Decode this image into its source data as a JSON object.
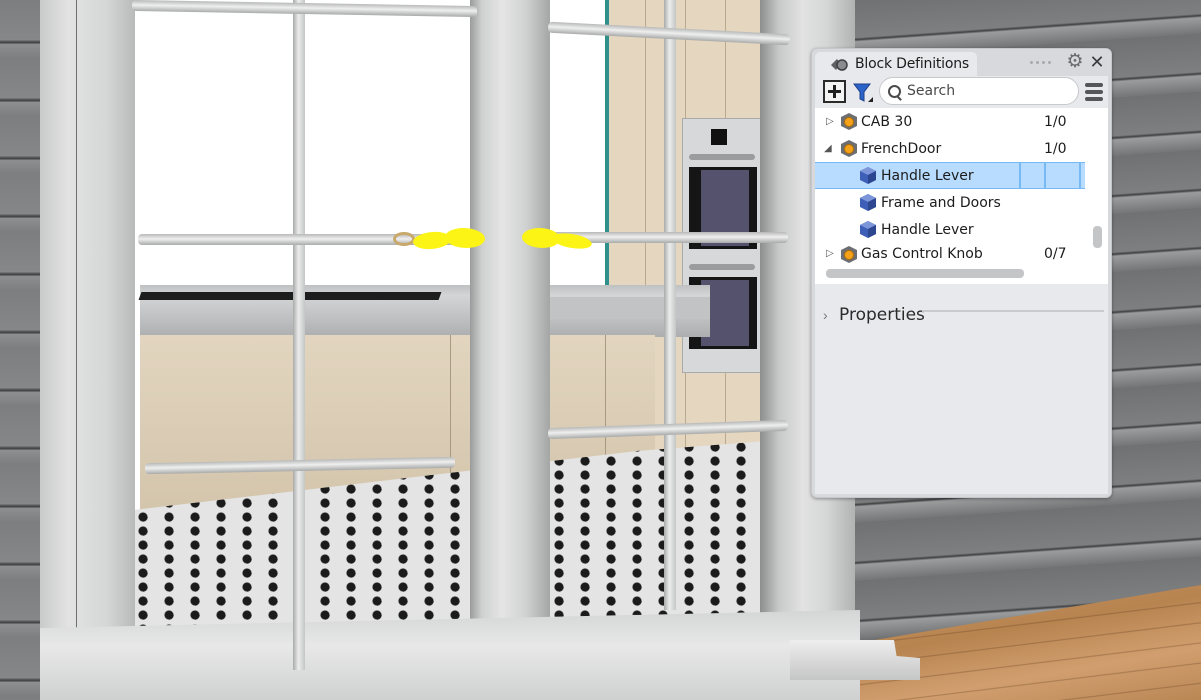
{
  "scene": {
    "description": "3D render: French door viewed from outside with kitchen interior",
    "highlight_color": "#fcf414",
    "accent_teal": "#2b8584"
  },
  "panel": {
    "title": "Block Definitions",
    "icons": {
      "tab": "block-definitions-icon",
      "gear": "gear-icon",
      "close": "close-icon",
      "add": "add-icon",
      "filter": "filter-icon",
      "search": "search-icon",
      "menu": "hamburger-menu-icon"
    },
    "gear_glyph": "⚙",
    "close_glyph": "✕",
    "search": {
      "placeholder": "Search",
      "value": ""
    },
    "tree": [
      {
        "label": "CAB 30",
        "count": "1/0",
        "level": 0,
        "expanded": false,
        "expander_glyph": "▷",
        "icon": "block-icon-orange"
      },
      {
        "label": "FrenchDoor",
        "count": "1/0",
        "level": 0,
        "expanded": true,
        "expander_glyph": "◢",
        "icon": "block-icon-orange"
      },
      {
        "label": "Handle Lever",
        "count": "",
        "level": 1,
        "selected": true,
        "icon": "block-icon-blue"
      },
      {
        "label": "Frame and Doors",
        "count": "",
        "level": 1,
        "icon": "block-icon-blue"
      },
      {
        "label": "Handle Lever",
        "count": "",
        "level": 1,
        "icon": "block-icon-blue"
      },
      {
        "label": "Gas Control Knob",
        "count": "0/7",
        "level": 0,
        "expanded": false,
        "expander_glyph": "▷",
        "icon": "block-icon-orange"
      }
    ],
    "properties": {
      "label": "Properties",
      "chevron_glyph": "›"
    }
  }
}
